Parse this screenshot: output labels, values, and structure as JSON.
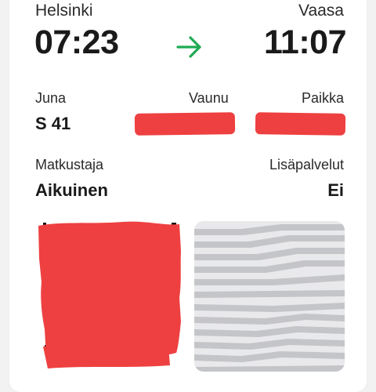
{
  "journey": {
    "from_city": "Helsinki",
    "to_city": "Vaasa",
    "departure_time": "07:23",
    "arrival_time": "11:07",
    "arrow_icon": "arrow-right-icon",
    "accent_color": "#1faa53"
  },
  "details": {
    "train_label": "Juna",
    "train_value": "S 41",
    "car_label": "Vaunu",
    "seat_label": "Paikka",
    "passenger_label": "Matkustaja",
    "passenger_value": "Aikuinen",
    "extras_label": "Lisäpalvelut",
    "extras_value": "Ei"
  },
  "colors": {
    "redaction": "#ee4040"
  }
}
